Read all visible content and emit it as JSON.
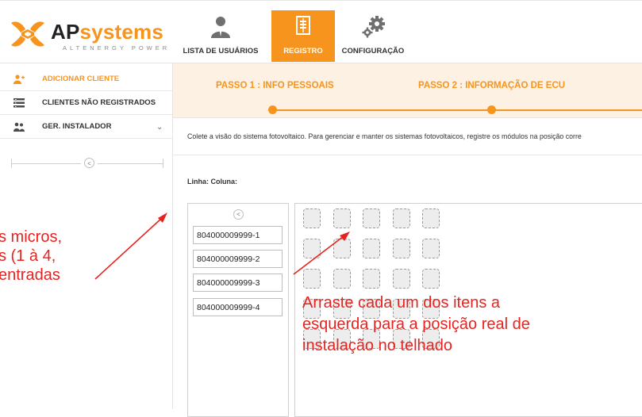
{
  "logo": {
    "brand_ap": "AP",
    "brand_systems": "systems",
    "tagline": "ALTENERGY POWER"
  },
  "nav": {
    "users_label": "LISTA DE USUÁRIOS",
    "register_label": "REGISTRO",
    "config_label": "CONFIGURAÇÃO",
    "active": "REGISTRO"
  },
  "sidebar": {
    "items": [
      {
        "label": "ADICIONAR CLIENTE",
        "icon": "add-user-icon",
        "active": true
      },
      {
        "label": "CLIENTES NÃO REGISTRADOS",
        "icon": "list-icon",
        "active": false
      },
      {
        "label": "GER. INSTALADOR",
        "icon": "users-icon",
        "active": false
      }
    ]
  },
  "steps": {
    "step1": "PASSO 1 : INFO PESSOAIS",
    "step2": "PASSO 2 : INFORMAÇÃO DE ECU"
  },
  "description": "Colete a visão do sistema fotovoltaico. Para gerenciar e manter os sistemas fotovoltaicos, registre os módulos na posição corre",
  "row_col_label": "Linha: Coluna:",
  "serials": [
    "804000009999-1",
    "804000009999-2",
    "804000009999-3",
    "804000009999-4"
  ],
  "grid": {
    "rows": 5,
    "cols": 5
  },
  "annotations": {
    "left": [
      "s micros,",
      "s (1 à 4,",
      "entradas"
    ],
    "right": [
      "Arraste cada um dos itens a",
      "esquerda para a posição real de",
      "instalação no telhado"
    ]
  },
  "colors": {
    "accent": "#f7941d",
    "annotation": "#e8231f",
    "step_bg": "#fdf1e3"
  }
}
